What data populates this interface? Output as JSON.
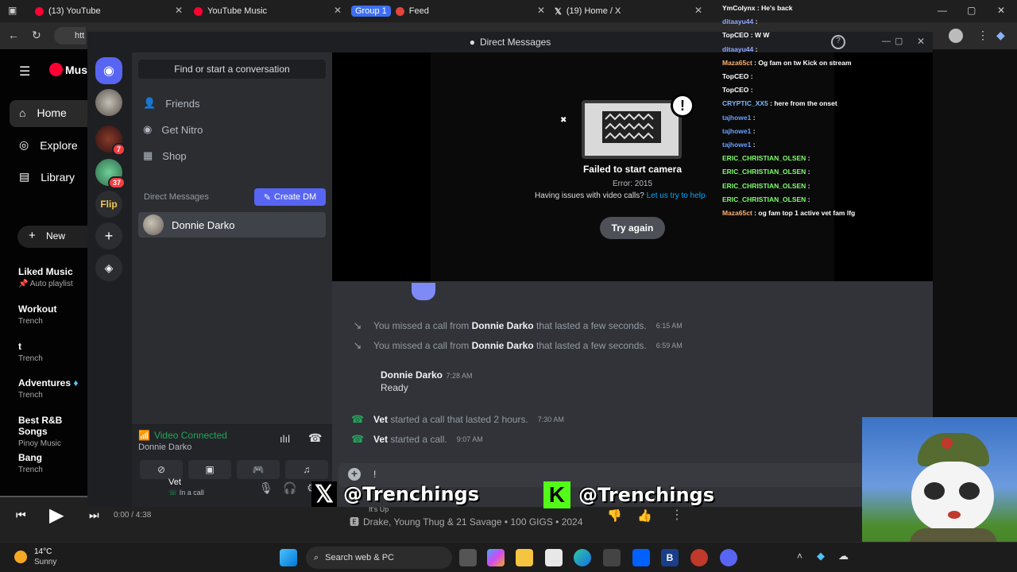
{
  "browser": {
    "tabs": [
      {
        "label": "(13) YouTube"
      },
      {
        "label": "YouTube Music"
      },
      {
        "group": "Group 1",
        "label": "Feed"
      },
      {
        "label": "(19) Home / X"
      }
    ],
    "url": "htt"
  },
  "ytmusic": {
    "logo": "Mus",
    "nav": [
      "Home",
      "Explore",
      "Library"
    ],
    "new_label": "New",
    "playlists": [
      {
        "title": "Liked Music",
        "subtitle": "Auto playlist"
      },
      {
        "title": "Workout",
        "subtitle": "Trench"
      },
      {
        "title": "t",
        "subtitle": "Trench"
      },
      {
        "title": "Adventures",
        "subtitle": "Trench"
      },
      {
        "title": "Best R&B Songs",
        "subtitle": "Pinoy Music"
      },
      {
        "title": "Bang",
        "subtitle": "Trench"
      }
    ],
    "player": {
      "time": "0:00 / 4:38",
      "track_partial": "It's Up",
      "artist_line": "Drake, Young Thug & 21 Savage • 100 GIGS • 2024"
    }
  },
  "discord": {
    "window_title": "Direct Messages",
    "guild_badges": [
      "7",
      "37"
    ],
    "find_conversation": "Find or start a conversation",
    "menu": [
      "Friends",
      "Get Nitro",
      "Shop"
    ],
    "dm_header": "Direct Messages",
    "create_dm": "Create DM",
    "dm_user": "Donnie Darko",
    "voice": {
      "status": "Video Connected",
      "channel": "Donnie Darko"
    },
    "user": {
      "name": "Vet",
      "status": "In a call"
    },
    "camera": {
      "title": "Failed to start camera",
      "error": "Error: 2015",
      "help_prefix": "Having issues with video calls?",
      "help_link": "Let us try to help",
      "retry": "Try again"
    },
    "messages": [
      {
        "type": "missed",
        "prefix": "You missed a call from",
        "name": "Donnie Darko",
        "suffix": "that lasted a few seconds.",
        "time": "6:15 AM"
      },
      {
        "type": "missed",
        "prefix": "You missed a call from",
        "name": "Donnie Darko",
        "suffix": "that lasted a few seconds.",
        "time": "6:59 AM"
      },
      {
        "type": "chat",
        "name": "Donnie Darko",
        "time": "7:28 AM",
        "text": "Ready"
      },
      {
        "type": "call",
        "name": "Vet",
        "text": "started a call that lasted 2 hours.",
        "time": "7:30 AM"
      },
      {
        "type": "call",
        "name": "Vet",
        "text": "started a call.",
        "time": "9:07 AM"
      }
    ],
    "input_value": "!"
  },
  "twitch_chat": [
    {
      "user": "YmColynx",
      "msg": "He's back",
      "color": "#ffffff"
    },
    {
      "user": "ditaayu44",
      "msg": "",
      "color": "#8fa8ff"
    },
    {
      "user": "TopCEO",
      "msg": "W W",
      "color": "#ffffff"
    },
    {
      "user": "ditaayu44",
      "msg": "",
      "color": "#8fa8ff"
    },
    {
      "user": "Maza65ct",
      "msg": "Og fam on tw Kick on stream",
      "color": "#ffb070"
    },
    {
      "user": "TopCEO",
      "msg": "",
      "color": "#ffffff"
    },
    {
      "user": "TopCEO",
      "msg": "",
      "color": "#ffffff"
    },
    {
      "user": "CRYPTIC_XX5",
      "msg": "here from the onset",
      "color": "#7ab8ff"
    },
    {
      "user": "tajhowe1",
      "msg": "",
      "color": "#6aa0ff"
    },
    {
      "user": "tajhowe1",
      "msg": "",
      "color": "#6aa0ff"
    },
    {
      "user": "tajhowe1",
      "msg": "",
      "color": "#6aa0ff"
    },
    {
      "user": "ERIC_CHRISTIAN_OLSEN",
      "msg": "",
      "color": "#7dff6a"
    },
    {
      "user": "ERIC_CHRISTIAN_OLSEN",
      "msg": "",
      "color": "#7dff6a"
    },
    {
      "user": "ERIC_CHRISTIAN_OLSEN",
      "msg": "",
      "color": "#7dff6a"
    },
    {
      "user": "ERIC_CHRISTIAN_OLSEN",
      "msg": "",
      "color": "#7dff6a"
    },
    {
      "user": "Maza65ct",
      "msg": "og fam top 1 active vet fam lfg",
      "color": "#ffb070"
    }
  ],
  "overlay": {
    "x_handle": "@Trenchings",
    "kick_handle": "@Trenchings"
  },
  "taskbar": {
    "temp": "14°C",
    "weather": "Sunny",
    "search": "Search web & PC"
  },
  "colors": {
    "discord_blurple": "#5865f2",
    "discord_green": "#23a55a",
    "kick_green": "#53fc18"
  }
}
